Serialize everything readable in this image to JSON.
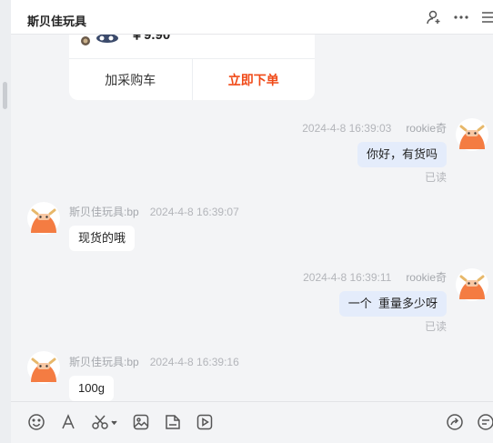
{
  "header": {
    "title": "斯贝佳玩具"
  },
  "product": {
    "price": "￥9.90",
    "add_cart_label": "加采购车",
    "buy_now_label": "立即下单"
  },
  "messages": [
    {
      "time": "2024-4-8 16:39:03",
      "sender": "rookie奇",
      "text": "你好，有货吗",
      "status": "已读"
    },
    {
      "sender": "斯贝佳玩具:bp",
      "time": "2024-4-8 16:39:07",
      "text": "现货的哦"
    },
    {
      "time": "2024-4-8 16:39:11",
      "sender": "rookie奇",
      "text": "一个  重量多少呀",
      "status": "已读"
    },
    {
      "sender": "斯贝佳玩具:bp",
      "time": "2024-4-8 16:39:16",
      "text": "100g"
    }
  ],
  "colors": {
    "accent": "#f04a18",
    "bubble_out": "#e4ecfb",
    "avatar": "#f47c42"
  },
  "toolbar": {
    "icons": [
      "emoji-icon",
      "font-icon",
      "scissors-icon",
      "image-icon",
      "file-icon",
      "video-icon",
      "share-icon",
      "quick-reply-icon"
    ]
  }
}
